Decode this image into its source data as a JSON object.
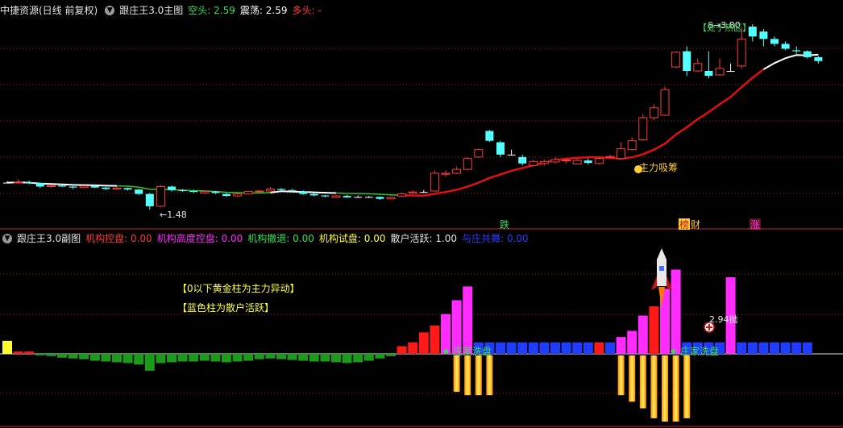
{
  "main_header": {
    "security": "中捷资源(日线 前复权)",
    "indicator": "跟庄王3.0主图",
    "items": [
      {
        "label": "空头:",
        "value": "2.59",
        "color": "#33e05a"
      },
      {
        "label": "震荡:",
        "value": "2.59",
        "color": "#ffffff"
      },
      {
        "label": "多头:",
        "value": "-",
        "color": "#ff3b3b"
      }
    ]
  },
  "main_annotations": {
    "low_price": "←1.48",
    "high_price": "6→3.80",
    "hot_zone": "【处于热区】",
    "accumulation": "主力吸筹",
    "tag_fall": "跌",
    "tag_ranked": "榜",
    "tag_finance": "财",
    "tag_rise": "涨"
  },
  "sub_header": {
    "indicator": "跟庄王3.0副图",
    "items": [
      {
        "label": "机构控盘:",
        "value": "0.00",
        "color": "#ff3b3b"
      },
      {
        "label": "机构高度控盘:",
        "value": "0.00",
        "color": "#ff2bff"
      },
      {
        "label": "机构撤退:",
        "value": "0.00",
        "color": "#33e05a"
      },
      {
        "label": "机构试盘:",
        "value": "0.00",
        "color": "#ffff40"
      },
      {
        "label": "散户活跃:",
        "value": "1.00",
        "color": "#e6e6e6"
      },
      {
        "label": "与庄共舞:",
        "value": "0.00",
        "color": "#2a3cff"
      }
    ]
  },
  "sub_annotations": {
    "note_gold": "【0以下黄金柱为主力异动】",
    "note_blue": "【蓝色柱为散户活跃】",
    "wash_1": "庄家洗盘",
    "wash_2": "庄家洗盘",
    "sell_signal": "2.94抛"
  },
  "colors": {
    "up": "#ff3b3b",
    "down": "#54ffff",
    "magenta": "#ff2bff",
    "blue": "#1f3cff",
    "green": "#1c9a1c",
    "gold": "#ffcc00",
    "border": "#c8222a"
  },
  "candles": [
    [
      2.03,
      2.03,
      2.06,
      2.02
    ],
    [
      2.03,
      2.04,
      2.1,
      2.01
    ],
    [
      2.04,
      2.02,
      2.07,
      2.0
    ],
    [
      2.02,
      1.95,
      2.03,
      1.92
    ],
    [
      1.95,
      1.97,
      1.99,
      1.93
    ],
    [
      1.97,
      1.95,
      1.98,
      1.94
    ],
    [
      1.95,
      1.93,
      1.96,
      1.9
    ],
    [
      1.93,
      1.96,
      1.97,
      1.92
    ],
    [
      1.96,
      1.93,
      1.97,
      1.92
    ],
    [
      1.93,
      1.9,
      1.94,
      1.88
    ],
    [
      1.9,
      1.92,
      1.94,
      1.89
    ],
    [
      1.92,
      1.89,
      1.93,
      1.87
    ],
    [
      1.89,
      1.8,
      1.9,
      1.78
    ],
    [
      1.8,
      1.55,
      1.82,
      1.48
    ],
    [
      1.55,
      1.95,
      1.98,
      1.53
    ],
    [
      1.95,
      1.88,
      1.97,
      1.85
    ],
    [
      1.88,
      1.86,
      1.9,
      1.84
    ],
    [
      1.86,
      1.84,
      1.88,
      1.82
    ],
    [
      1.82,
      1.85,
      1.87,
      1.8
    ],
    [
      1.85,
      1.82,
      1.86,
      1.8
    ],
    [
      1.8,
      1.76,
      1.82,
      1.74
    ],
    [
      1.76,
      1.8,
      1.82,
      1.74
    ],
    [
      1.8,
      1.85,
      1.86,
      1.79
    ],
    [
      1.85,
      1.86,
      1.88,
      1.83
    ],
    [
      1.86,
      1.9,
      1.94,
      1.85
    ],
    [
      1.9,
      1.88,
      1.92,
      1.86
    ],
    [
      1.88,
      1.87,
      1.9,
      1.85
    ],
    [
      1.85,
      1.8,
      1.87,
      1.78
    ],
    [
      1.8,
      1.77,
      1.82,
      1.75
    ],
    [
      1.77,
      1.75,
      1.78,
      1.73
    ],
    [
      1.73,
      1.76,
      1.78,
      1.72
    ],
    [
      1.76,
      1.73,
      1.78,
      1.72
    ],
    [
      1.74,
      1.74,
      1.77,
      1.72
    ],
    [
      1.74,
      1.74,
      1.76,
      1.72
    ],
    [
      1.74,
      1.7,
      1.75,
      1.68
    ],
    [
      1.7,
      1.73,
      1.75,
      1.69
    ],
    [
      1.75,
      1.8,
      1.83,
      1.74
    ],
    [
      1.82,
      1.84,
      1.87,
      1.81
    ],
    [
      1.84,
      1.84,
      1.88,
      1.82
    ],
    [
      1.86,
      2.22,
      2.28,
      1.85
    ],
    [
      2.2,
      2.22,
      2.28,
      2.15
    ],
    [
      2.22,
      2.3,
      2.35,
      2.2
    ],
    [
      2.3,
      2.52,
      2.55,
      2.28
    ],
    [
      2.55,
      2.7,
      2.72,
      2.53
    ],
    [
      3.08,
      2.88,
      3.1,
      2.86
    ],
    [
      2.85,
      2.6,
      2.88,
      2.55
    ],
    [
      2.6,
      2.6,
      2.7,
      2.58
    ],
    [
      2.55,
      2.42,
      2.6,
      2.38
    ],
    [
      2.38,
      2.46,
      2.5,
      2.36
    ],
    [
      2.42,
      2.46,
      2.5,
      2.38
    ],
    [
      2.45,
      2.5,
      2.55,
      2.42
    ],
    [
      2.48,
      2.49,
      2.52,
      2.42
    ],
    [
      2.41,
      2.48,
      2.52,
      2.4
    ],
    [
      2.48,
      2.43,
      2.52,
      2.4
    ],
    [
      2.42,
      2.52,
      2.55,
      2.4
    ],
    [
      2.55,
      2.56,
      2.6,
      2.52
    ],
    [
      2.52,
      2.72,
      2.85,
      2.5
    ],
    [
      2.7,
      2.88,
      2.95,
      2.68
    ],
    [
      2.9,
      3.35,
      3.42,
      2.88
    ],
    [
      3.35,
      3.55,
      3.62,
      3.3
    ],
    [
      3.4,
      3.92,
      3.98,
      3.38
    ],
    [
      4.38,
      4.68,
      4.7,
      4.36
    ],
    [
      4.7,
      4.3,
      4.8,
      4.2
    ],
    [
      4.3,
      4.45,
      4.55,
      4.28
    ],
    [
      4.3,
      4.2,
      4.7,
      4.15
    ],
    [
      4.22,
      4.35,
      4.55,
      4.2
    ],
    [
      4.3,
      4.3,
      4.45,
      4.28
    ],
    [
      4.4,
      4.95,
      5.2,
      4.35
    ],
    [
      5.2,
      5.0,
      5.25,
      4.9
    ],
    [
      5.1,
      4.95,
      5.15,
      4.8
    ],
    [
      4.95,
      4.85,
      5.0,
      4.8
    ],
    [
      4.85,
      4.75,
      4.9,
      4.72
    ],
    [
      4.72,
      4.7,
      4.8,
      4.65
    ],
    [
      4.7,
      4.58,
      4.72,
      4.55
    ],
    [
      4.58,
      4.5,
      4.6,
      4.45
    ]
  ],
  "sub_series": [
    {
      "type": "pos",
      "v": 0.17,
      "c": "yellow"
    },
    {
      "type": "pos",
      "v": 0.03,
      "c": "red"
    },
    {
      "type": "pos",
      "v": 0.03,
      "c": "red"
    },
    {
      "type": "neg",
      "v": 0.02
    },
    {
      "type": "neg",
      "v": 0.03
    },
    {
      "type": "neg",
      "v": 0.05
    },
    {
      "type": "neg",
      "v": 0.06
    },
    {
      "type": "neg",
      "v": 0.07
    },
    {
      "type": "neg",
      "v": 0.09
    },
    {
      "type": "neg",
      "v": 0.1
    },
    {
      "type": "neg",
      "v": 0.11
    },
    {
      "type": "neg",
      "v": 0.12
    },
    {
      "type": "neg",
      "v": 0.14
    },
    {
      "type": "neg",
      "v": 0.22
    },
    {
      "type": "neg",
      "v": 0.12
    },
    {
      "type": "neg",
      "v": 0.11
    },
    {
      "type": "neg",
      "v": 0.1
    },
    {
      "type": "neg",
      "v": 0.1
    },
    {
      "type": "neg",
      "v": 0.09
    },
    {
      "type": "neg",
      "v": 0.1
    },
    {
      "type": "neg",
      "v": 0.11
    },
    {
      "type": "neg",
      "v": 0.1
    },
    {
      "type": "neg",
      "v": 0.09
    },
    {
      "type": "neg",
      "v": 0.07
    },
    {
      "type": "neg",
      "v": 0.06
    },
    {
      "type": "neg",
      "v": 0.07
    },
    {
      "type": "neg",
      "v": 0.08
    },
    {
      "type": "neg",
      "v": 0.09
    },
    {
      "type": "neg",
      "v": 0.1
    },
    {
      "type": "neg",
      "v": 0.1
    },
    {
      "type": "neg",
      "v": 0.11
    },
    {
      "type": "neg",
      "v": 0.12
    },
    {
      "type": "neg",
      "v": 0.11
    },
    {
      "type": "neg",
      "v": 0.09
    },
    {
      "type": "neg",
      "v": 0.06
    },
    {
      "type": "neg",
      "v": 0.03
    },
    {
      "type": "pos",
      "v": 0.1,
      "c": "red"
    },
    {
      "type": "pos",
      "v": 0.15,
      "c": "red"
    },
    {
      "type": "pos",
      "v": 0.28,
      "c": "red"
    },
    {
      "type": "pos",
      "v": 0.37,
      "c": "red"
    },
    {
      "type": "pos",
      "v": 0.52,
      "c": "magenta"
    },
    {
      "type": "pos",
      "v": 0.7,
      "c": "magenta"
    },
    {
      "type": "pos",
      "v": 0.88,
      "c": "magenta"
    },
    {
      "type": "pos",
      "v": 0.15,
      "c": "blue"
    },
    {
      "type": "pos",
      "v": 0.15,
      "c": "blue"
    },
    {
      "type": "pos",
      "v": 0.15,
      "c": "blue"
    },
    {
      "type": "pos",
      "v": 0.15,
      "c": "blue"
    },
    {
      "type": "pos",
      "v": 0.15,
      "c": "blue"
    },
    {
      "type": "pos",
      "v": 0.15,
      "c": "blue"
    },
    {
      "type": "pos",
      "v": 0.15,
      "c": "blue"
    },
    {
      "type": "pos",
      "v": 0.15,
      "c": "blue"
    },
    {
      "type": "pos",
      "v": 0.15,
      "c": "blue"
    },
    {
      "type": "pos",
      "v": 0.15,
      "c": "blue"
    },
    {
      "type": "pos",
      "v": 0.15,
      "c": "blue"
    },
    {
      "type": "pos",
      "v": 0.15,
      "c": "red"
    },
    {
      "type": "pos",
      "v": 0.15,
      "c": "blue"
    },
    {
      "type": "pos",
      "v": 0.22,
      "c": "magenta"
    },
    {
      "type": "pos",
      "v": 0.3,
      "c": "magenta"
    },
    {
      "type": "pos",
      "v": 0.5,
      "c": "magenta"
    },
    {
      "type": "pos",
      "v": 0.62,
      "c": "red"
    },
    {
      "type": "pos",
      "v": 0.85,
      "c": "magenta"
    },
    {
      "type": "pos",
      "v": 1.1,
      "c": "magenta"
    },
    {
      "type": "pos",
      "v": 0.15,
      "c": "blue"
    },
    {
      "type": "pos",
      "v": 0.15,
      "c": "blue"
    },
    {
      "type": "pos",
      "v": 0.15,
      "c": "blue"
    },
    {
      "type": "pos",
      "v": 0.15,
      "c": "blue"
    },
    {
      "type": "pos",
      "v": 1.0,
      "c": "magenta"
    },
    {
      "type": "pos",
      "v": 0.15,
      "c": "blue"
    },
    {
      "type": "pos",
      "v": 0.15,
      "c": "blue"
    },
    {
      "type": "pos",
      "v": 0.15,
      "c": "blue"
    },
    {
      "type": "pos",
      "v": 0.15,
      "c": "blue"
    },
    {
      "type": "pos",
      "v": 0.15,
      "c": "blue"
    },
    {
      "type": "pos",
      "v": 0.15,
      "c": "blue"
    },
    {
      "type": "pos",
      "v": 0.15,
      "c": "blue"
    }
  ],
  "gold_columns": [
    {
      "i": 41,
      "depth": 0.55
    },
    {
      "i": 42,
      "depth": 0.6
    },
    {
      "i": 43,
      "depth": 0.6
    },
    {
      "i": 44,
      "depth": 0.6
    },
    {
      "i": 56,
      "depth": 0.6
    },
    {
      "i": 57,
      "depth": 0.7
    },
    {
      "i": 58,
      "depth": 0.8
    },
    {
      "i": 59,
      "depth": 0.95
    },
    {
      "i": 60,
      "depth": 1.0
    },
    {
      "i": 61,
      "depth": 1.0
    },
    {
      "i": 62,
      "depth": 0.95
    }
  ]
}
